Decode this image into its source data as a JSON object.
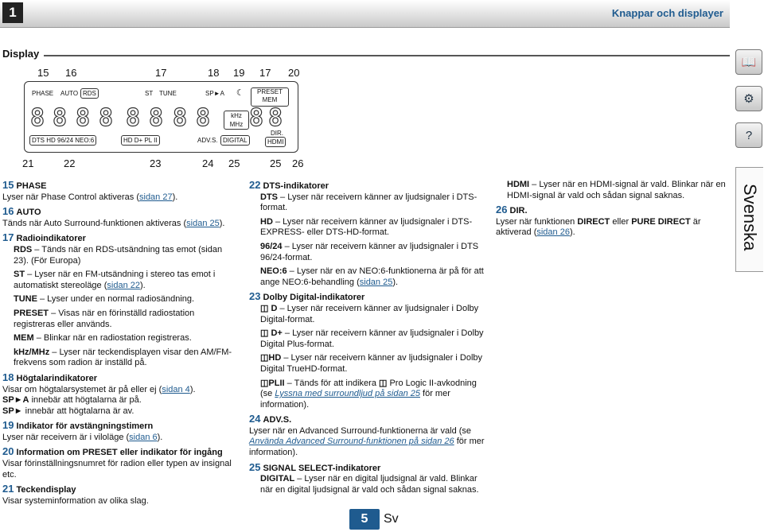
{
  "header": {
    "chapter": "1",
    "title": "Knappar och displayer"
  },
  "section": "Display",
  "side": {
    "lang": "Svenska"
  },
  "callouts_top": [
    "15",
    "16",
    "17",
    "18",
    "19",
    "17",
    "20"
  ],
  "callouts_bottom": [
    "21",
    "22",
    "23",
    "24",
    "25",
    "25",
    "26"
  ],
  "panel": {
    "phase": "PHASE",
    "auto": "AUTO",
    "rds": "RDS",
    "st": "ST",
    "tune": "TUNE",
    "sp": "SP►A",
    "preset": "PRESET",
    "mem": "MEM",
    "khz": "kHz",
    "mhz": "MHz",
    "dir": "DIR.",
    "dts": "DTS HD 96/24 NEO:6",
    "dolby": "HD D+ PL II",
    "advs": "ADV.S.",
    "digital": "DIGITAL",
    "hdmi": "HDMI"
  },
  "c1": {
    "n15": "15",
    "t15": "PHASE",
    "d15": "Lyser när Phase Control aktiveras (",
    "l15": "sidan 27",
    "e15": ").",
    "n16": "16",
    "t16": "AUTO",
    "d16": "Tänds när Auto Surround-funktionen aktiveras (",
    "l16": "sidan 25",
    "e16": ").",
    "n17": "17",
    "t17": "Radioindikatorer",
    "rds_k": "RDS",
    "rds_v": " – Tänds när en RDS-utsändning tas emot (sidan 23). (För Europa)",
    "st_k": "ST",
    "st_v": " – Lyser när en FM-utsändning i stereo tas emot i automatiskt stereoläge (",
    "st_l": "sidan 22",
    "st_e": ").",
    "tune_k": "TUNE",
    "tune_v": " – Lyser under en normal radiosändning.",
    "preset_k": "PRESET",
    "preset_v": " – Visas när en förinställd radiostation registreras eller används.",
    "mem_k": "MEM",
    "mem_v": " – Blinkar när en radiostation registreras.",
    "khz_k": "kHz/MHz",
    "khz_v": " – Lyser när teckendisplayen visar den AM/FM-frekvens som radion är inställd på.",
    "n18": "18",
    "t18": "Högtalarindikatorer",
    "d18": "Visar om högtalarsystemet är på eller ej (",
    "l18": "sidan 4",
    "e18": ").",
    "spa_k": "SP►A",
    "spa_v": " innebär att högtalarna är på.",
    "sp_k": "SP►",
    "sp_v": " innebär att högtalarna är av.",
    "n19": "19",
    "t19": "Indikator för avstängningstimern",
    "d19": "Lyser när receivern är i viloläge (",
    "l19": "sidan 6",
    "e19": ").",
    "n20": "20",
    "t20": "Information om PRESET eller indikator för ingång",
    "d20": "Visar förinställningsnumret för radion eller typen av insignal etc.",
    "n21": "21",
    "t21": "Teckendisplay",
    "d21": "Visar systeminformation av olika slag."
  },
  "c2": {
    "n22": "22",
    "t22": "DTS-indikatorer",
    "dts_k": "DTS",
    "dts_v": " – Lyser när receivern känner av ljudsignaler i DTS-format.",
    "hd_k": "HD",
    "hd_v": " – Lyser när receivern känner av ljudsignaler i DTS-EXPRESS- eller DTS-HD-format.",
    "k96_k": "96/24",
    "k96_v": " – Lyser när receivern känner av ljudsignaler i DTS 96/24-format.",
    "neo_k": "NEO:6",
    "neo_v": " – Lyser när en av NEO:6-funktionerna är på för att ange NEO:6-behandling (",
    "neo_l": "sidan 25",
    "neo_e": ").",
    "n23": "23",
    "t23": "Dolby Digital-indikatorer",
    "dd_k": "D",
    "dd_v": " – Lyser när receivern känner av ljudsignaler i Dolby Digital-format.",
    "ddp_k": "D+",
    "ddp_v": " – Lyser när receivern känner av ljudsignaler i Dolby Digital Plus-format.",
    "dhd_k": "HD",
    "dhd_v": " – Lyser när receivern känner av ljudsignaler i Dolby Digital TrueHD-format.",
    "pl_k": "PLII",
    "pl_v": " – Tänds för att indikera ",
    "pl_v2": " Pro Logic II-avkodning (se ",
    "pl_l": "Lyssna med surroundljud på sidan 25",
    "pl_e": " för mer information).",
    "n24": "24",
    "t24": "ADV.S.",
    "d24": "Lyser när en Advanced Surround-funktionerna är vald (se ",
    "l24": "Använda Advanced Surround-funktionen på sidan 26",
    "e24": " för mer information).",
    "n25": "25",
    "t25": "SIGNAL SELECT-indikatorer",
    "dig_k": "DIGITAL",
    "dig_v": " – Lyser när en digital ljudsignal är vald. Blinkar när en digital ljudsignal är vald och sådan signal saknas."
  },
  "c3": {
    "hdmi_k": "HDMI",
    "hdmi_v": " – Lyser när en HDMI-signal är vald. Blinkar när en HDMI-signal är vald och sådan signal saknas.",
    "n26": "26",
    "t26": "DIR.",
    "d26a": "Lyser när funktionen ",
    "d26b": "DIRECT",
    "d26c": " eller ",
    "d26d": "PURE DIRECT",
    "d26e": " är aktiverad (",
    "l26": "sidan 26",
    "e26": ")."
  },
  "footer": {
    "page": "5",
    "lang": "Sv"
  }
}
